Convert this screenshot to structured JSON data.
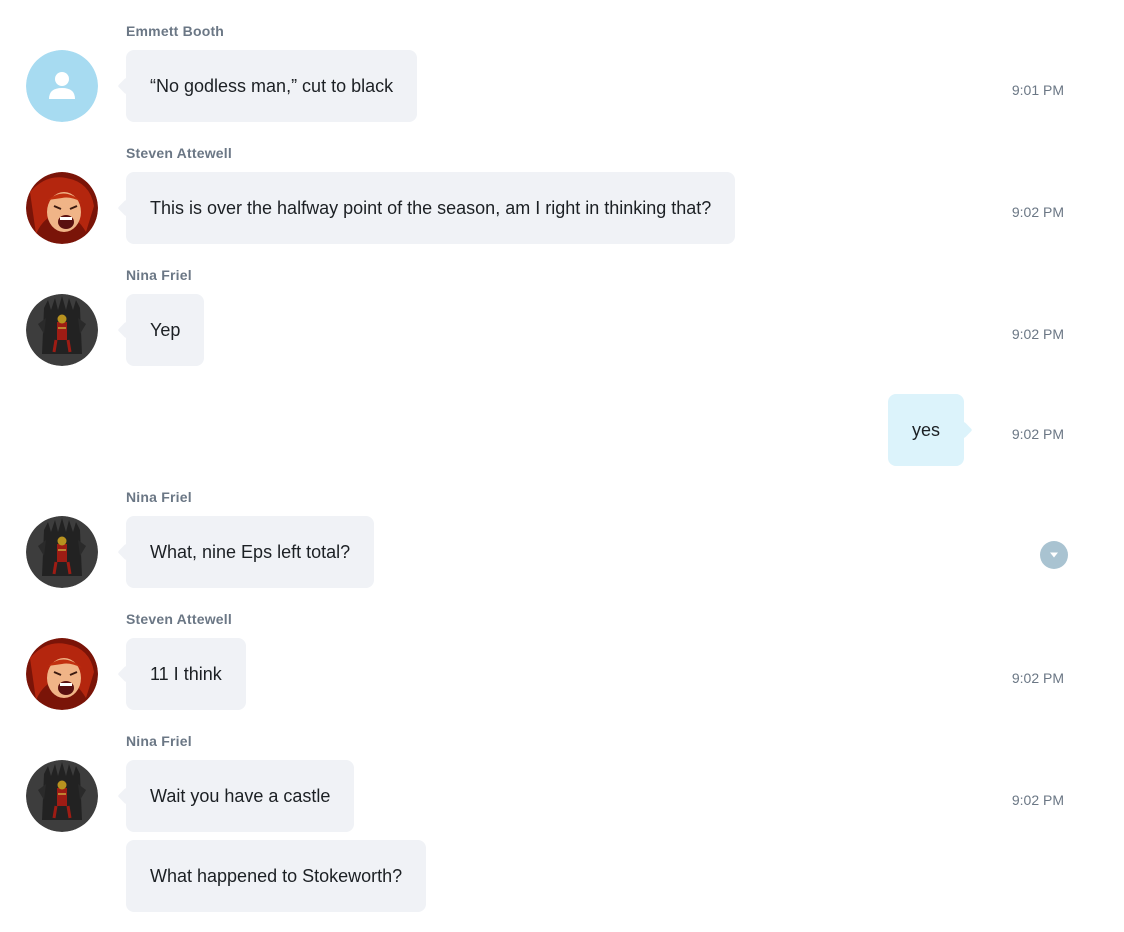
{
  "colors": {
    "bubble_other": "#f0f2f6",
    "bubble_mine": "#dcf3fb",
    "name_text": "#6b7785",
    "menu_button": "#a9c3d1",
    "default_avatar": "#a7dbf1"
  },
  "messages": [
    {
      "sender": "Emmett Booth",
      "avatar": "default-user-icon",
      "text": "“No godless man,” cut to black",
      "time": "9:01 PM"
    },
    {
      "sender": "Steven Attewell",
      "avatar": "red-haired-avatar",
      "text": "This is over the halfway point of the season, am I right in thinking that?",
      "time": "9:02 PM"
    },
    {
      "sender": "Nina Friel",
      "avatar": "iron-throne-avatar",
      "text": "Yep",
      "time": "9:02 PM"
    },
    {
      "sender": "",
      "avatar": "",
      "text": "yes",
      "time": "9:02 PM"
    },
    {
      "sender": "Nina Friel",
      "avatar": "iron-throne-avatar",
      "text": "What, nine Eps left total?",
      "time": "",
      "hover_action": "chevron-down-icon"
    },
    {
      "sender": "Steven Attewell",
      "avatar": "red-haired-avatar",
      "text": "11 I think",
      "time": "9:02 PM"
    },
    {
      "sender": "Nina Friel",
      "avatar": "iron-throne-avatar",
      "text": "Wait you have a castle",
      "time": "9:02 PM"
    },
    {
      "sender": "",
      "avatar": "",
      "text": "What happened to Stokeworth?",
      "time": ""
    }
  ]
}
